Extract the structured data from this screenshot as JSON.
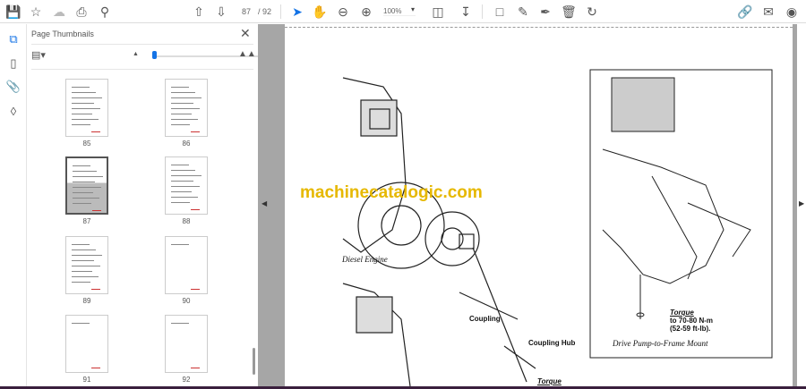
{
  "toolbar": {
    "current_page": "87",
    "total_pages": "/ 92",
    "zoom": "100%"
  },
  "panel": {
    "title": "Page Thumbnails"
  },
  "thumbnails": [
    {
      "label": "85"
    },
    {
      "label": "86"
    },
    {
      "label": "87",
      "selected": true
    },
    {
      "label": "88"
    },
    {
      "label": "89"
    },
    {
      "label": "90"
    },
    {
      "label": "91"
    },
    {
      "label": "92"
    }
  ],
  "document": {
    "watermark": "machinecatalogic.com",
    "diesel_engine": "Diesel Engine",
    "coupling": "Coupling",
    "coupling_hub": "Coupling Hub",
    "torque_bottom": "Torque",
    "torque_title": "Torque",
    "torque_line1": "to 70-80 N-m",
    "torque_line2": "(52-59 ft-lb).",
    "caption": "Drive Pump-to-Frame Mount"
  },
  "colors": {
    "accent": "#1473e6",
    "watermark": "#e6b800",
    "bottom_bar": "#3a1f3d"
  }
}
